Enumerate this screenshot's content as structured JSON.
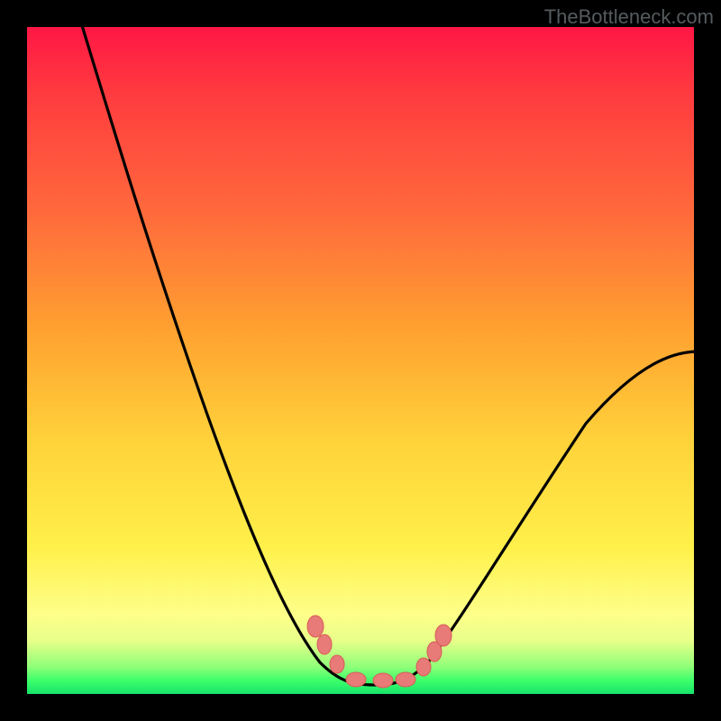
{
  "watermark": "TheBottleneck.com",
  "colors": {
    "frame": "#000000",
    "curve": "#000000",
    "marker_fill": "#e87a77",
    "marker_stroke": "#d85c58",
    "gradient_stops": [
      "#ff1744",
      "#ff6a3c",
      "#ffd23a",
      "#feff89",
      "#3cff6a"
    ]
  },
  "chart_data": {
    "type": "line",
    "title": "",
    "xlabel": "",
    "ylabel": "",
    "xlim": [
      0,
      100
    ],
    "ylim": [
      0,
      100
    ],
    "grid": false,
    "legend": false,
    "note": "V-shaped bottleneck curve; y is percentage-like (0 at bottom/green, 100 at top/red). Values estimated from pixel positions.",
    "series": [
      {
        "name": "curve",
        "x": [
          8,
          13,
          18,
          23,
          28,
          33,
          38,
          42,
          44,
          46,
          48,
          51,
          55,
          58,
          60,
          63,
          68,
          75,
          82,
          90,
          100
        ],
        "y": [
          100,
          85,
          71,
          57,
          44,
          32,
          21,
          12,
          8,
          5,
          2,
          1,
          1,
          2,
          4,
          7,
          12,
          20,
          29,
          38,
          48
        ]
      }
    ],
    "markers": {
      "name": "highlight-points",
      "x": [
        43.2,
        44.6,
        46.5,
        49.3,
        53.4,
        56.8,
        59.5,
        61.1,
        62.4
      ],
      "y": [
        10.1,
        7.4,
        4.5,
        2.2,
        2.0,
        2.2,
        4.1,
        6.4,
        8.8
      ]
    }
  }
}
